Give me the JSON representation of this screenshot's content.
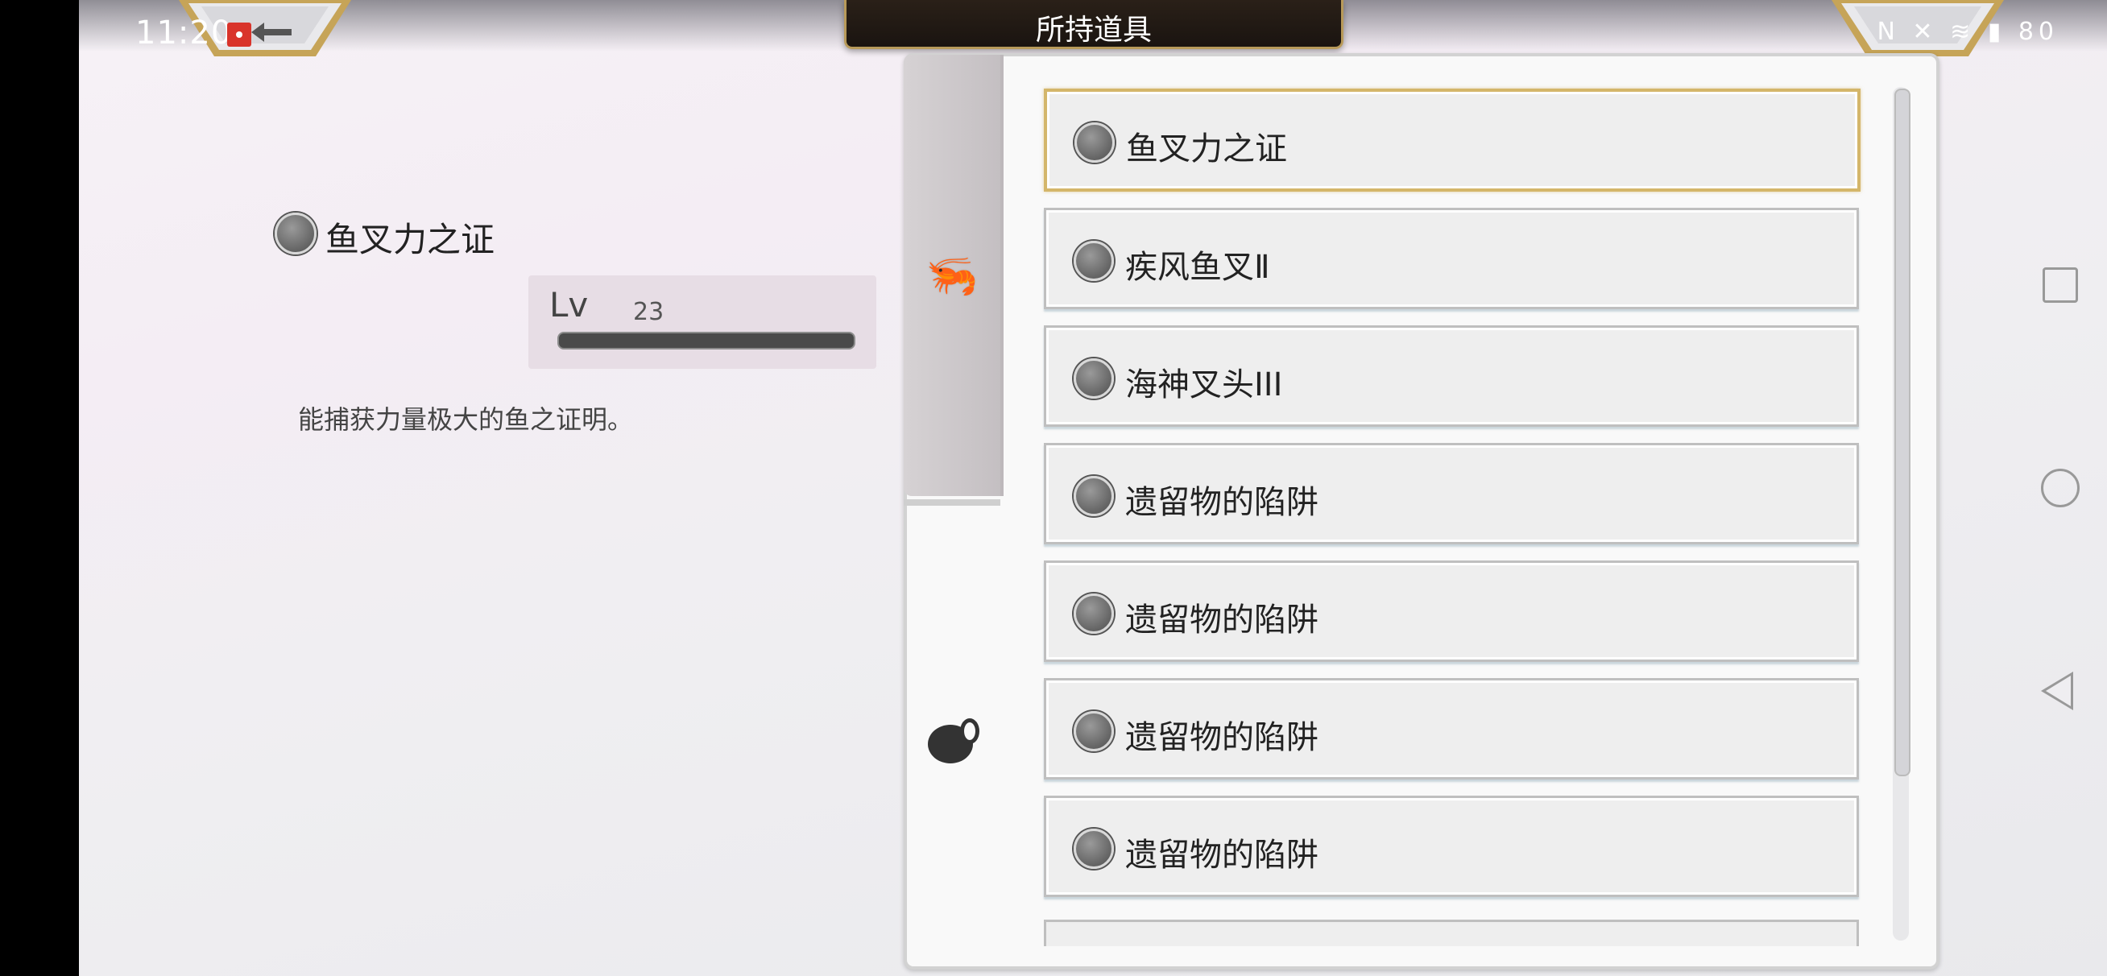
{
  "status_bar": {
    "time": "11:20",
    "right_text": "N ✕ ≋ ▮ 80"
  },
  "header": {
    "title": "所持道具"
  },
  "detail": {
    "item_name": "鱼叉力之证",
    "level_label": "Lv",
    "level_value": "23",
    "description": "能捕获力量极大的鱼之证明。"
  },
  "tabs": [
    {
      "icon": "shrimp-icon",
      "active": true
    },
    {
      "icon": "pot-icon",
      "active": false
    }
  ],
  "items": [
    {
      "label": "鱼叉力之证",
      "icon": "certificate-icon",
      "selected": true
    },
    {
      "label": "疾风鱼叉Ⅱ",
      "icon": "trident-icon",
      "selected": false
    },
    {
      "label": "海神叉头III",
      "icon": "trident-head-icon",
      "selected": false
    },
    {
      "label": "遗留物的陷阱",
      "icon": "trap-pot-icon",
      "selected": false
    },
    {
      "label": "遗留物的陷阱",
      "icon": "trap-pot-icon",
      "selected": false
    },
    {
      "label": "遗留物的陷阱",
      "icon": "trap-pot-icon",
      "selected": false
    },
    {
      "label": "遗留物的陷阱",
      "icon": "trap-pot-icon",
      "selected": false
    }
  ],
  "colors": {
    "selected_border": "#d4b66a",
    "accent_plate": "#1a1410"
  }
}
